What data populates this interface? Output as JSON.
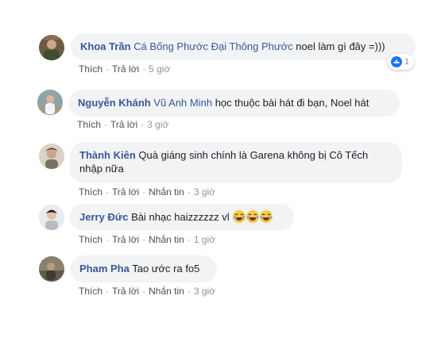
{
  "comments": [
    {
      "author": "Khoa Trần",
      "mention": "Cá Bống Phước Đại Thông Phước",
      "text": " noel làm gì đây =)))",
      "actions": [
        "Thích",
        "Trả lời"
      ],
      "time": "5 giờ",
      "reaction": {
        "icon": "haha-icon",
        "count": "1"
      }
    },
    {
      "author": "Nguyễn Khánh",
      "mention": "Vũ Anh Minh",
      "text": " học thuộc bài hát đi bạn, Noel hát",
      "actions": [
        "Thích",
        "Trả lời"
      ],
      "time": "3 giờ"
    },
    {
      "author": "Thành Kiên",
      "mention": "",
      "text": " Quà giáng sinh chính là Garena không bị Cô Tếch nhập nữa",
      "actions": [
        "Thích",
        "Trả lời",
        "Nhắn tin"
      ],
      "time": "3 giờ"
    },
    {
      "author": "Jerry Đức",
      "mention": "",
      "text": " Bài nhạc haizzzzzz vl",
      "emojis": [
        "laughing-emoji",
        "laughing-emoji",
        "laughing-emoji"
      ],
      "actions": [
        "Thích",
        "Trả lời",
        "Nhắn tin"
      ],
      "time": "1 giờ"
    },
    {
      "author": "Pham Pha",
      "mention": "",
      "text": " Tao ước ra fo5",
      "actions": [
        "Thích",
        "Trả lời",
        "Nhắn tin"
      ],
      "time": "3 giờ"
    }
  ],
  "colors": {
    "author": "#385898",
    "bubble": "#f2f3f5",
    "action": "#4b4f56",
    "meta": "#90949c"
  }
}
